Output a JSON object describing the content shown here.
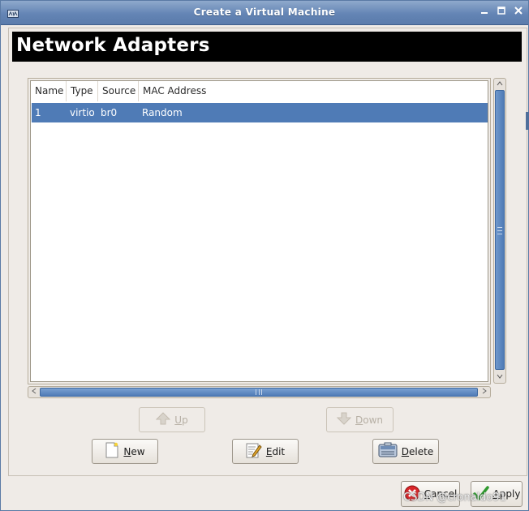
{
  "window": {
    "title": "Create a Virtual Machine"
  },
  "header": {
    "title": "Network Adapters"
  },
  "table": {
    "columns": [
      "Name",
      "Type",
      "Source",
      "MAC Address"
    ],
    "rows": [
      {
        "name": "1",
        "type": "virtio",
        "source": "br0",
        "mac": "Random",
        "selected": true
      }
    ]
  },
  "buttons": {
    "up": {
      "label": "Up",
      "mnemonic": "U",
      "rest": "p",
      "enabled": false
    },
    "down": {
      "label": "Down",
      "mnemonic": "D",
      "rest": "own",
      "enabled": false
    },
    "new": {
      "label": "New",
      "mnemonic": "N",
      "rest": "ew",
      "enabled": true
    },
    "edit": {
      "label": "Edit",
      "mnemonic": "E",
      "rest": "dit",
      "enabled": true
    },
    "delete": {
      "label": "Delete",
      "mnemonic": "D",
      "rest": "elete",
      "enabled": true
    },
    "cancel": {
      "label": "Cancel",
      "mnemonic": "C",
      "rest": "ancel",
      "enabled": true
    },
    "apply": {
      "label": "Apply",
      "mnemonic": "A",
      "rest": "pply",
      "enabled": true
    }
  },
  "icons": {
    "up": "arrow-up-icon",
    "down": "arrow-down-icon",
    "new": "new-document-icon",
    "edit": "edit-pencil-icon",
    "delete": "delete-icon",
    "cancel": "cancel-icon",
    "apply": "apply-check-icon"
  },
  "colors": {
    "selection": "#4f7bb6",
    "titlebar": "#6485b5",
    "header_band": "#000000"
  },
  "watermark": "CSDN @cronaldo91"
}
